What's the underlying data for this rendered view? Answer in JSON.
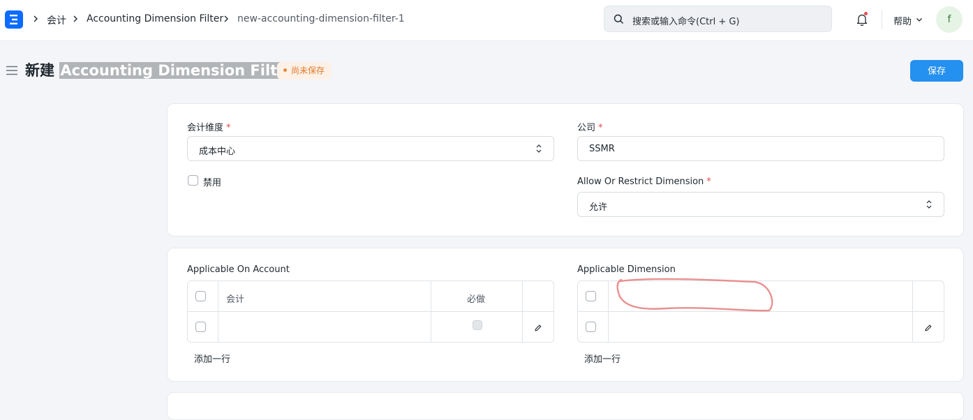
{
  "navbar": {
    "breadcrumbs": [
      "会计",
      "Accounting Dimension Filter",
      "new-accounting-dimension-filter-1"
    ],
    "search_placeholder": "搜索或输入命令(Ctrl + G)",
    "help_label": "帮助",
    "avatar_initial": "f"
  },
  "page": {
    "title_prefix": "新建",
    "title_doctype": "Accounting Dimension Filter",
    "status_badge": "尚未保存",
    "save_label": "保存"
  },
  "form": {
    "accounting_dimension": {
      "label": "会计维度",
      "value": "成本中心"
    },
    "company": {
      "label": "公司",
      "value": "SSMR"
    },
    "disabled": {
      "label": "禁用",
      "checked": false
    },
    "allow_or_restrict": {
      "label": "Allow Or Restrict Dimension",
      "value": "允许"
    }
  },
  "applicable_on_account": {
    "label": "Applicable On Account",
    "columns": [
      "会计",
      "必做"
    ],
    "add_row_label": "添加一行"
  },
  "applicable_dimension": {
    "label": "Applicable Dimension",
    "add_row_label": "添加一行"
  },
  "colors": {
    "primary": "#2490ef",
    "required": "#e24c4c",
    "badge_text": "#e07a2b",
    "annotation": "#e8908f"
  }
}
